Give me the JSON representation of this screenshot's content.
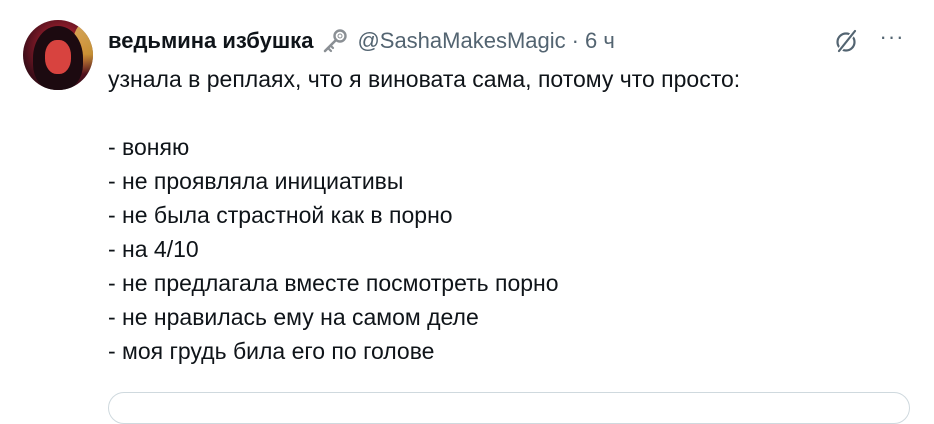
{
  "author": {
    "display_name": "ведьмина избушка",
    "badge_icon": "key-emoji-icon",
    "handle": "@SashaMakesMagic",
    "separator": "·",
    "time": "6 ч"
  },
  "actions": {
    "grok_icon": "grok-slash-icon",
    "more_label": "···"
  },
  "tweet": {
    "lines": [
      "узнала в реплаях, что я виновата сама, потому что просто:",
      "",
      "- воняю",
      "- не проявляла инициативы",
      "- не была страстной как в порно",
      "- на 4/10",
      "- не предлагала вместе посмотреть порно",
      "- не нравилась ему на самом деле",
      "- моя грудь била его по голове"
    ]
  },
  "colors": {
    "text": "#0f1419",
    "secondary": "#536471",
    "border": "#cfd9de"
  }
}
